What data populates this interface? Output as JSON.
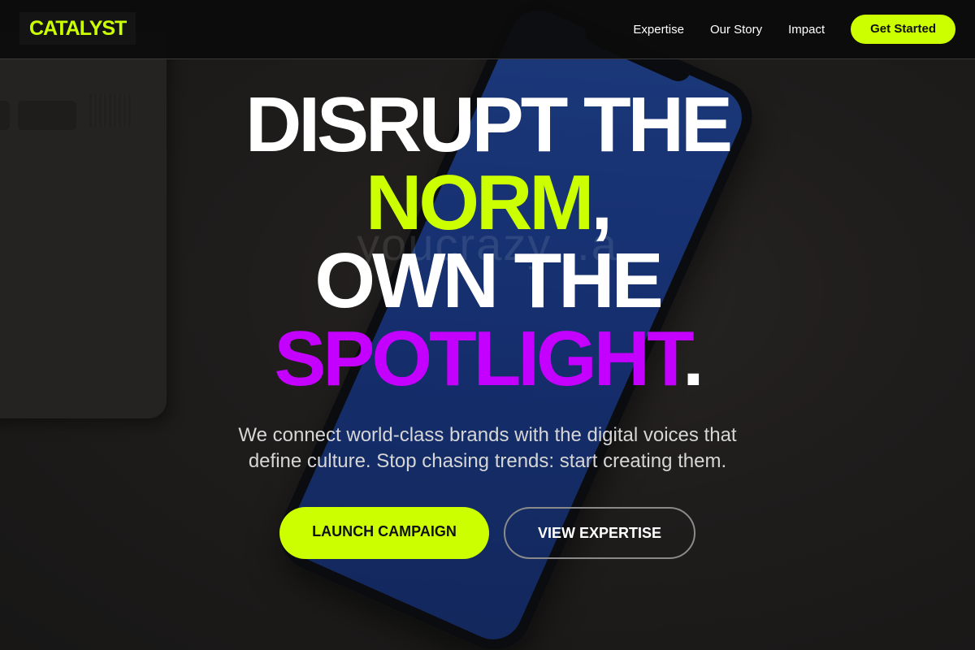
{
  "brand": {
    "logo_text": "CATALYST"
  },
  "nav": {
    "links": [
      "Expertise",
      "Our Story",
      "Impact"
    ],
    "cta_label": "Get Started"
  },
  "hero": {
    "line1": "DISRUPT THE",
    "line2_accent": "NORM",
    "line2_suffix": ",",
    "line3": "OWN THE",
    "line4_accent": "SPOTLIGHT",
    "line4_suffix": ".",
    "subtitle": "We connect world-class brands with the digital voices that define culture. Stop chasing trends: start creating them.",
    "watermark": "youcrazy...a",
    "primary_cta": "LAUNCH CAMPAIGN",
    "secondary_cta": "VIEW EXPERTISE"
  },
  "colors": {
    "accent_green": "#ccff00",
    "accent_purple": "#c400ff",
    "header_bg": "#0c0c0c"
  }
}
